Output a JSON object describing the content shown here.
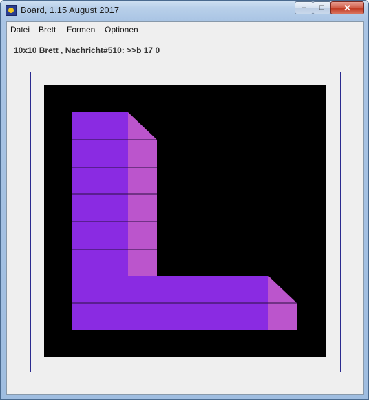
{
  "window": {
    "title": "Board, 1.15 August 2017",
    "controls": {
      "minimize": "–",
      "maximize": "□",
      "close": "✕"
    }
  },
  "menu": [
    {
      "label": "Datei"
    },
    {
      "label": "Brett"
    },
    {
      "label": "Formen"
    },
    {
      "label": "Optionen"
    }
  ],
  "status": {
    "text": "10x10 Brett , Nachricht#510: >>b 17 0"
  },
  "board": {
    "grid_size": 10,
    "background": "#000000",
    "frame_color": "#2b2b8f",
    "colors": {
      "face": "#8a2be2",
      "side": "#bb55cc",
      "line": "#2a1040"
    },
    "shape": "L",
    "vertical_bar_blocks": 6,
    "horizontal_bar_blocks": 2
  }
}
